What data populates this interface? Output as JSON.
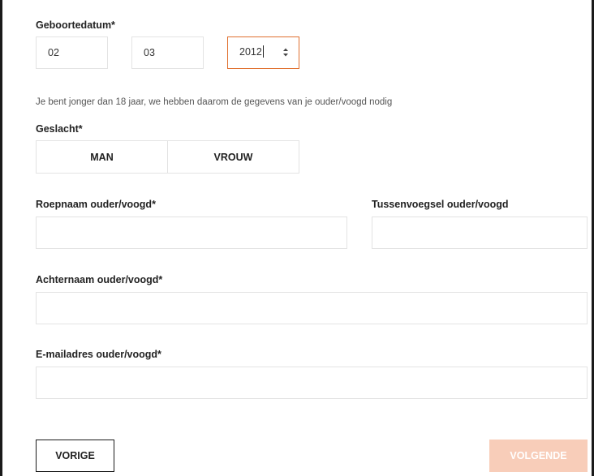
{
  "birthdate": {
    "label": "Geboortedatum*",
    "day": "02",
    "month": "03",
    "year": "2012"
  },
  "notice": "Je bent jonger dan 18 jaar, we hebben daarom de gegevens van je ouder/voogd nodig",
  "gender": {
    "label": "Geslacht*",
    "options": [
      "MAN",
      "VROUW"
    ]
  },
  "guardian": {
    "first_name_label": "Roepnaam ouder/voogd*",
    "first_name_value": "",
    "infix_label": "Tussenvoegsel ouder/voogd",
    "infix_value": "",
    "last_name_label": "Achternaam ouder/voogd*",
    "last_name_value": "",
    "email_label": "E-mailadres ouder/voogd*",
    "email_value": ""
  },
  "nav": {
    "prev_label": "VORIGE",
    "next_label": "VOLGENDE"
  },
  "colors": {
    "accent": "#e0702f",
    "next_disabled": "#f8cdb9",
    "border": "#e3e3e3"
  }
}
